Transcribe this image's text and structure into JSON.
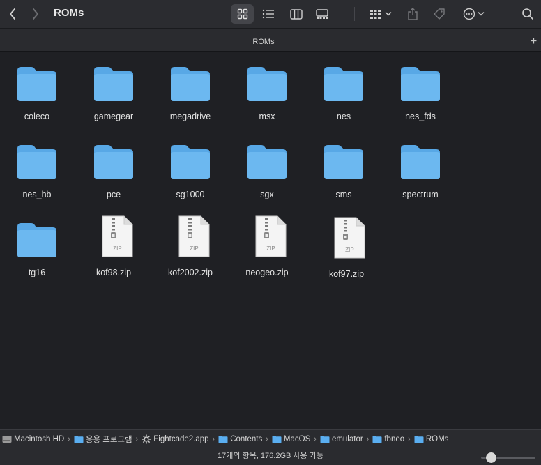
{
  "window": {
    "title": "ROMs"
  },
  "tab": {
    "label": "ROMs",
    "add_label": "+"
  },
  "items": [
    {
      "name": "coleco",
      "type": "folder"
    },
    {
      "name": "gamegear",
      "type": "folder"
    },
    {
      "name": "megadrive",
      "type": "folder"
    },
    {
      "name": "msx",
      "type": "folder"
    },
    {
      "name": "nes",
      "type": "folder"
    },
    {
      "name": "nes_fds",
      "type": "folder"
    },
    {
      "name": "nes_hb",
      "type": "folder"
    },
    {
      "name": "pce",
      "type": "folder"
    },
    {
      "name": "sg1000",
      "type": "folder"
    },
    {
      "name": "sgx",
      "type": "folder"
    },
    {
      "name": "sms",
      "type": "folder"
    },
    {
      "name": "spectrum",
      "type": "folder"
    },
    {
      "name": "tg16",
      "type": "folder"
    },
    {
      "name": "kof98.zip",
      "type": "zip",
      "badge": "ZIP"
    },
    {
      "name": "kof2002.zip",
      "type": "zip",
      "badge": "ZIP"
    },
    {
      "name": "neogeo.zip",
      "type": "zip",
      "badge": "ZIP"
    },
    {
      "name": "kof97.zip",
      "type": "zip",
      "badge": "ZIP"
    }
  ],
  "path": [
    {
      "label": "Macintosh HD",
      "icon": "disk-icon"
    },
    {
      "label": "응용 프로그램",
      "icon": "folder-icon"
    },
    {
      "label": "Fightcade2.app",
      "icon": "app-icon"
    },
    {
      "label": "Contents",
      "icon": "folder-icon"
    },
    {
      "label": "MacOS",
      "icon": "folder-icon"
    },
    {
      "label": "emulator",
      "icon": "folder-icon"
    },
    {
      "label": "fbneo",
      "icon": "folder-icon"
    },
    {
      "label": "ROMs",
      "icon": "folder-icon"
    }
  ],
  "status": {
    "text": "17개의 항목, 176.2GB 사용 가능",
    "icon_size_level": 0.18
  },
  "colors": {
    "folder": "#6cb8f0",
    "folder_tab": "#58a8e6",
    "accent": "#2f8ff0"
  }
}
